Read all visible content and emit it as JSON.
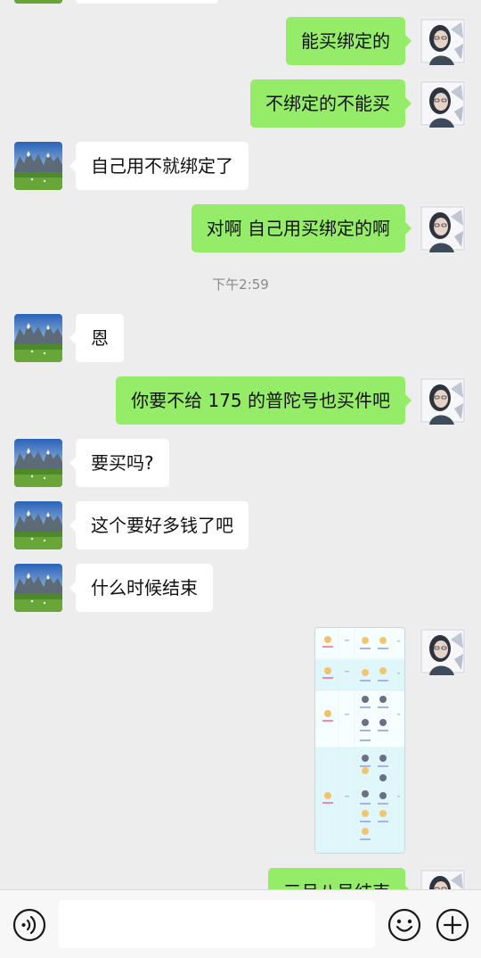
{
  "messages": [
    {
      "side": "right",
      "text": "能买绑定的"
    },
    {
      "side": "right",
      "text": "不绑定的不能买"
    },
    {
      "side": "left",
      "text": "自己用不就绑定了"
    },
    {
      "side": "right",
      "text": "对啊 自己用买绑定的啊"
    },
    {
      "side": "left",
      "text": "恩"
    },
    {
      "side": "right",
      "text": "你要不给 175 的普陀号也买件吧"
    },
    {
      "side": "left",
      "text": "要买吗?"
    },
    {
      "side": "left",
      "text": "这个要好多钱了吧"
    },
    {
      "side": "left",
      "text": "什么时候结束"
    },
    {
      "side": "right",
      "text": "三月八号结束"
    }
  ],
  "timestamp": "下午2:59",
  "image_message": {
    "type": "screenshot-image",
    "side": "right"
  },
  "input": {
    "placeholder": "",
    "value": ""
  },
  "icons": {
    "voice": "voice-icon",
    "emoji": "emoji-icon",
    "plus": "plus-icon"
  },
  "colors": {
    "background": "#ededed",
    "sent_bubble": "#95ec69",
    "received_bubble": "#ffffff",
    "timestamp_text": "#8a8a8a"
  }
}
